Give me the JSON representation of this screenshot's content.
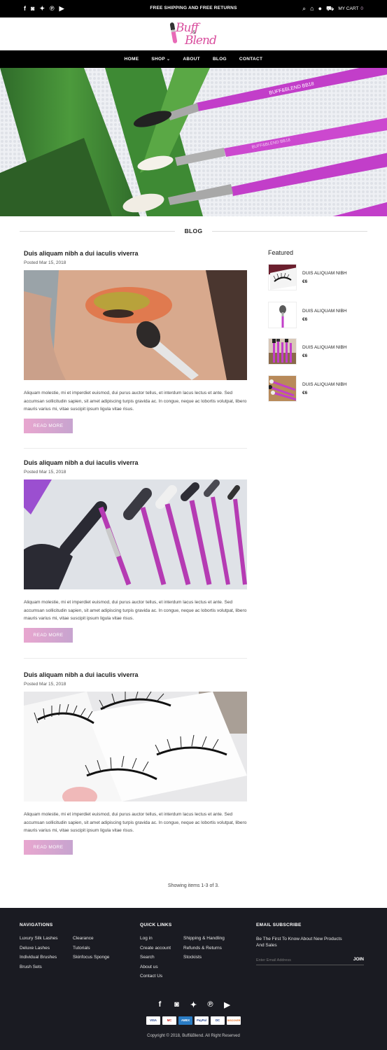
{
  "topbar": {
    "social_icons": [
      "facebook-icon",
      "instagram-icon",
      "twitter-icon",
      "pinterest-icon",
      "youtube-icon"
    ],
    "promo": "FREE SHIPPING AND FREE RETURNS",
    "cart_label": "MY CART",
    "cart_count": "0"
  },
  "brand": {
    "logo_line1": "Buff",
    "logo_amp": "&",
    "logo_line2": "Blend"
  },
  "nav": {
    "items": [
      {
        "label": "HOME"
      },
      {
        "label": "SHOP",
        "has_dropdown": true
      },
      {
        "label": "ABOUT"
      },
      {
        "label": "BLOG"
      },
      {
        "label": "CONTACT"
      }
    ]
  },
  "hero": {
    "brush_text_1": "BUFF&BLEND  BB18",
    "brush_text_2": "BUFF&BLEND  BB18"
  },
  "page": {
    "heading": "BLOG",
    "pagination_info": "Showing items 1-3 of 3."
  },
  "posts": [
    {
      "title": "Duis aliquam nibh a dui iaculis viverra",
      "date": "Posted Mar 15, 2018",
      "excerpt": "Aliquam molestie, mi et imperdiet euismod, dui purus auctor tellus, et interdum lacus lectus et ante. Sed accumsan sollicitudin sapien, sit amet adipiscing turpis gravida ac. In congue, neque ac lobortis volutpat, libero mauris varius mi, vitae suscipit ipsum ligula vitae risus.",
      "button": "READ MORE"
    },
    {
      "title": "Duis aliquam nibh a dui iaculis viverra",
      "date": "Posted Mar 15, 2018",
      "excerpt": "Aliquam molestie, mi et imperdiet euismod, dui purus auctor tellus, et interdum lacus lectus et ante. Sed accumsan sollicitudin sapien, sit amet adipiscing turpis gravida ac. In congue, neque ac lobortis volutpat, libero mauris varius mi, vitae suscipit ipsum ligula vitae risus.",
      "button": "READ MORE"
    },
    {
      "title": "Duis aliquam nibh a dui iaculis viverra",
      "date": "Posted Mar 15, 2018",
      "excerpt": "Aliquam molestie, mi et imperdiet euismod, dui purus auctor tellus, et interdum lacus lectus et ante. Sed accumsan sollicitudin sapien, sit amet adipiscing turpis gravida ac. In congue, neque ac lobortis volutpat, libero mauris varius mi, vitae suscipit ipsum ligula vitae risus.",
      "button": "READ MORE"
    }
  ],
  "sidebar": {
    "heading": "Featured",
    "items": [
      {
        "name": "DUIS ALIQUAM NIBH",
        "price": "€6"
      },
      {
        "name": "DUIS ALIQUAM NIBH",
        "price": "€6"
      },
      {
        "name": "DUIS ALIQUAM NIBH",
        "price": "€6"
      },
      {
        "name": "DUIS ALIQUAM NIBH",
        "price": "€6"
      }
    ]
  },
  "footer": {
    "navigations_title": "NAVIGATIONS",
    "navigations_col1": [
      "Luxury Silk Lashes",
      "Deluxe Lashes",
      "Individual Brushes",
      "Brush Sets"
    ],
    "navigations_col2": [
      "Clearance",
      "Tutorials",
      "Skinfocus Sponge"
    ],
    "quick_links_title": "QUICK LINKS",
    "quick_links_col1": [
      "Log in",
      "Create account",
      "Search",
      "About us",
      "Contact Us"
    ],
    "quick_links_col2": [
      "Shipping & Handling",
      "Refunds & Returns",
      "Stockists"
    ],
    "subscribe_title": "EMAIL SUBSCRIBE",
    "subscribe_text": "Be The First To Know About New Products And Sales",
    "email_placeholder": "Enter Email Address",
    "join_label": "JOIN",
    "social_icons": [
      "facebook-icon",
      "instagram-icon",
      "twitter-icon",
      "pinterest-icon",
      "youtube-icon"
    ],
    "payments": [
      "VISA",
      "MC",
      "AMEX",
      "PayPal",
      "DC",
      "DISCOVER"
    ],
    "copyright": "Copyright © 2018, Buff&Blend. All Right Reserved"
  },
  "colors": {
    "accent_pink": "#e8a6cf",
    "accent_lilac": "#c7a4cf",
    "logo_pink": "#d94f9e",
    "dark": "#000000",
    "footer_bg": "#1a1b22"
  }
}
